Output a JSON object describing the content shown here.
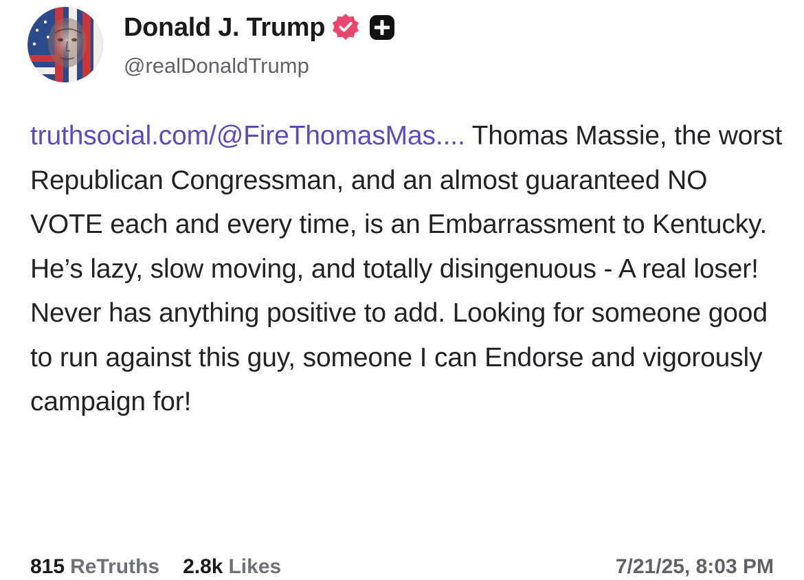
{
  "post": {
    "author": {
      "display_name": "Donald J. Trump",
      "handle": "@realDonaldTrump",
      "verified_icon": "verified-badge-icon",
      "follow_icon": "follow-plus-icon"
    },
    "link_text": "truthsocial.com/@FireThomasMas....",
    "body_text": " Thomas Massie, the worst Republican Congressman, and an almost guaranteed NO VOTE each and every time, is an Embarrassment to Kentucky. He’s lazy, slow moving, and totally disingenuous - A real loser! Never has anything positive to add. Looking for someone good to run against this guy, someone I can Endorse and vigorously campaign for!",
    "stats": {
      "retruths_count": "815",
      "retruths_label": "ReTruths",
      "likes_count": "2.8k",
      "likes_label": "Likes"
    },
    "timestamp": "7/21/25, 8:03 PM"
  },
  "colors": {
    "link": "#5b49c9",
    "verified_badge": "#e8476b",
    "text": "#222326",
    "muted": "#5f6369"
  }
}
